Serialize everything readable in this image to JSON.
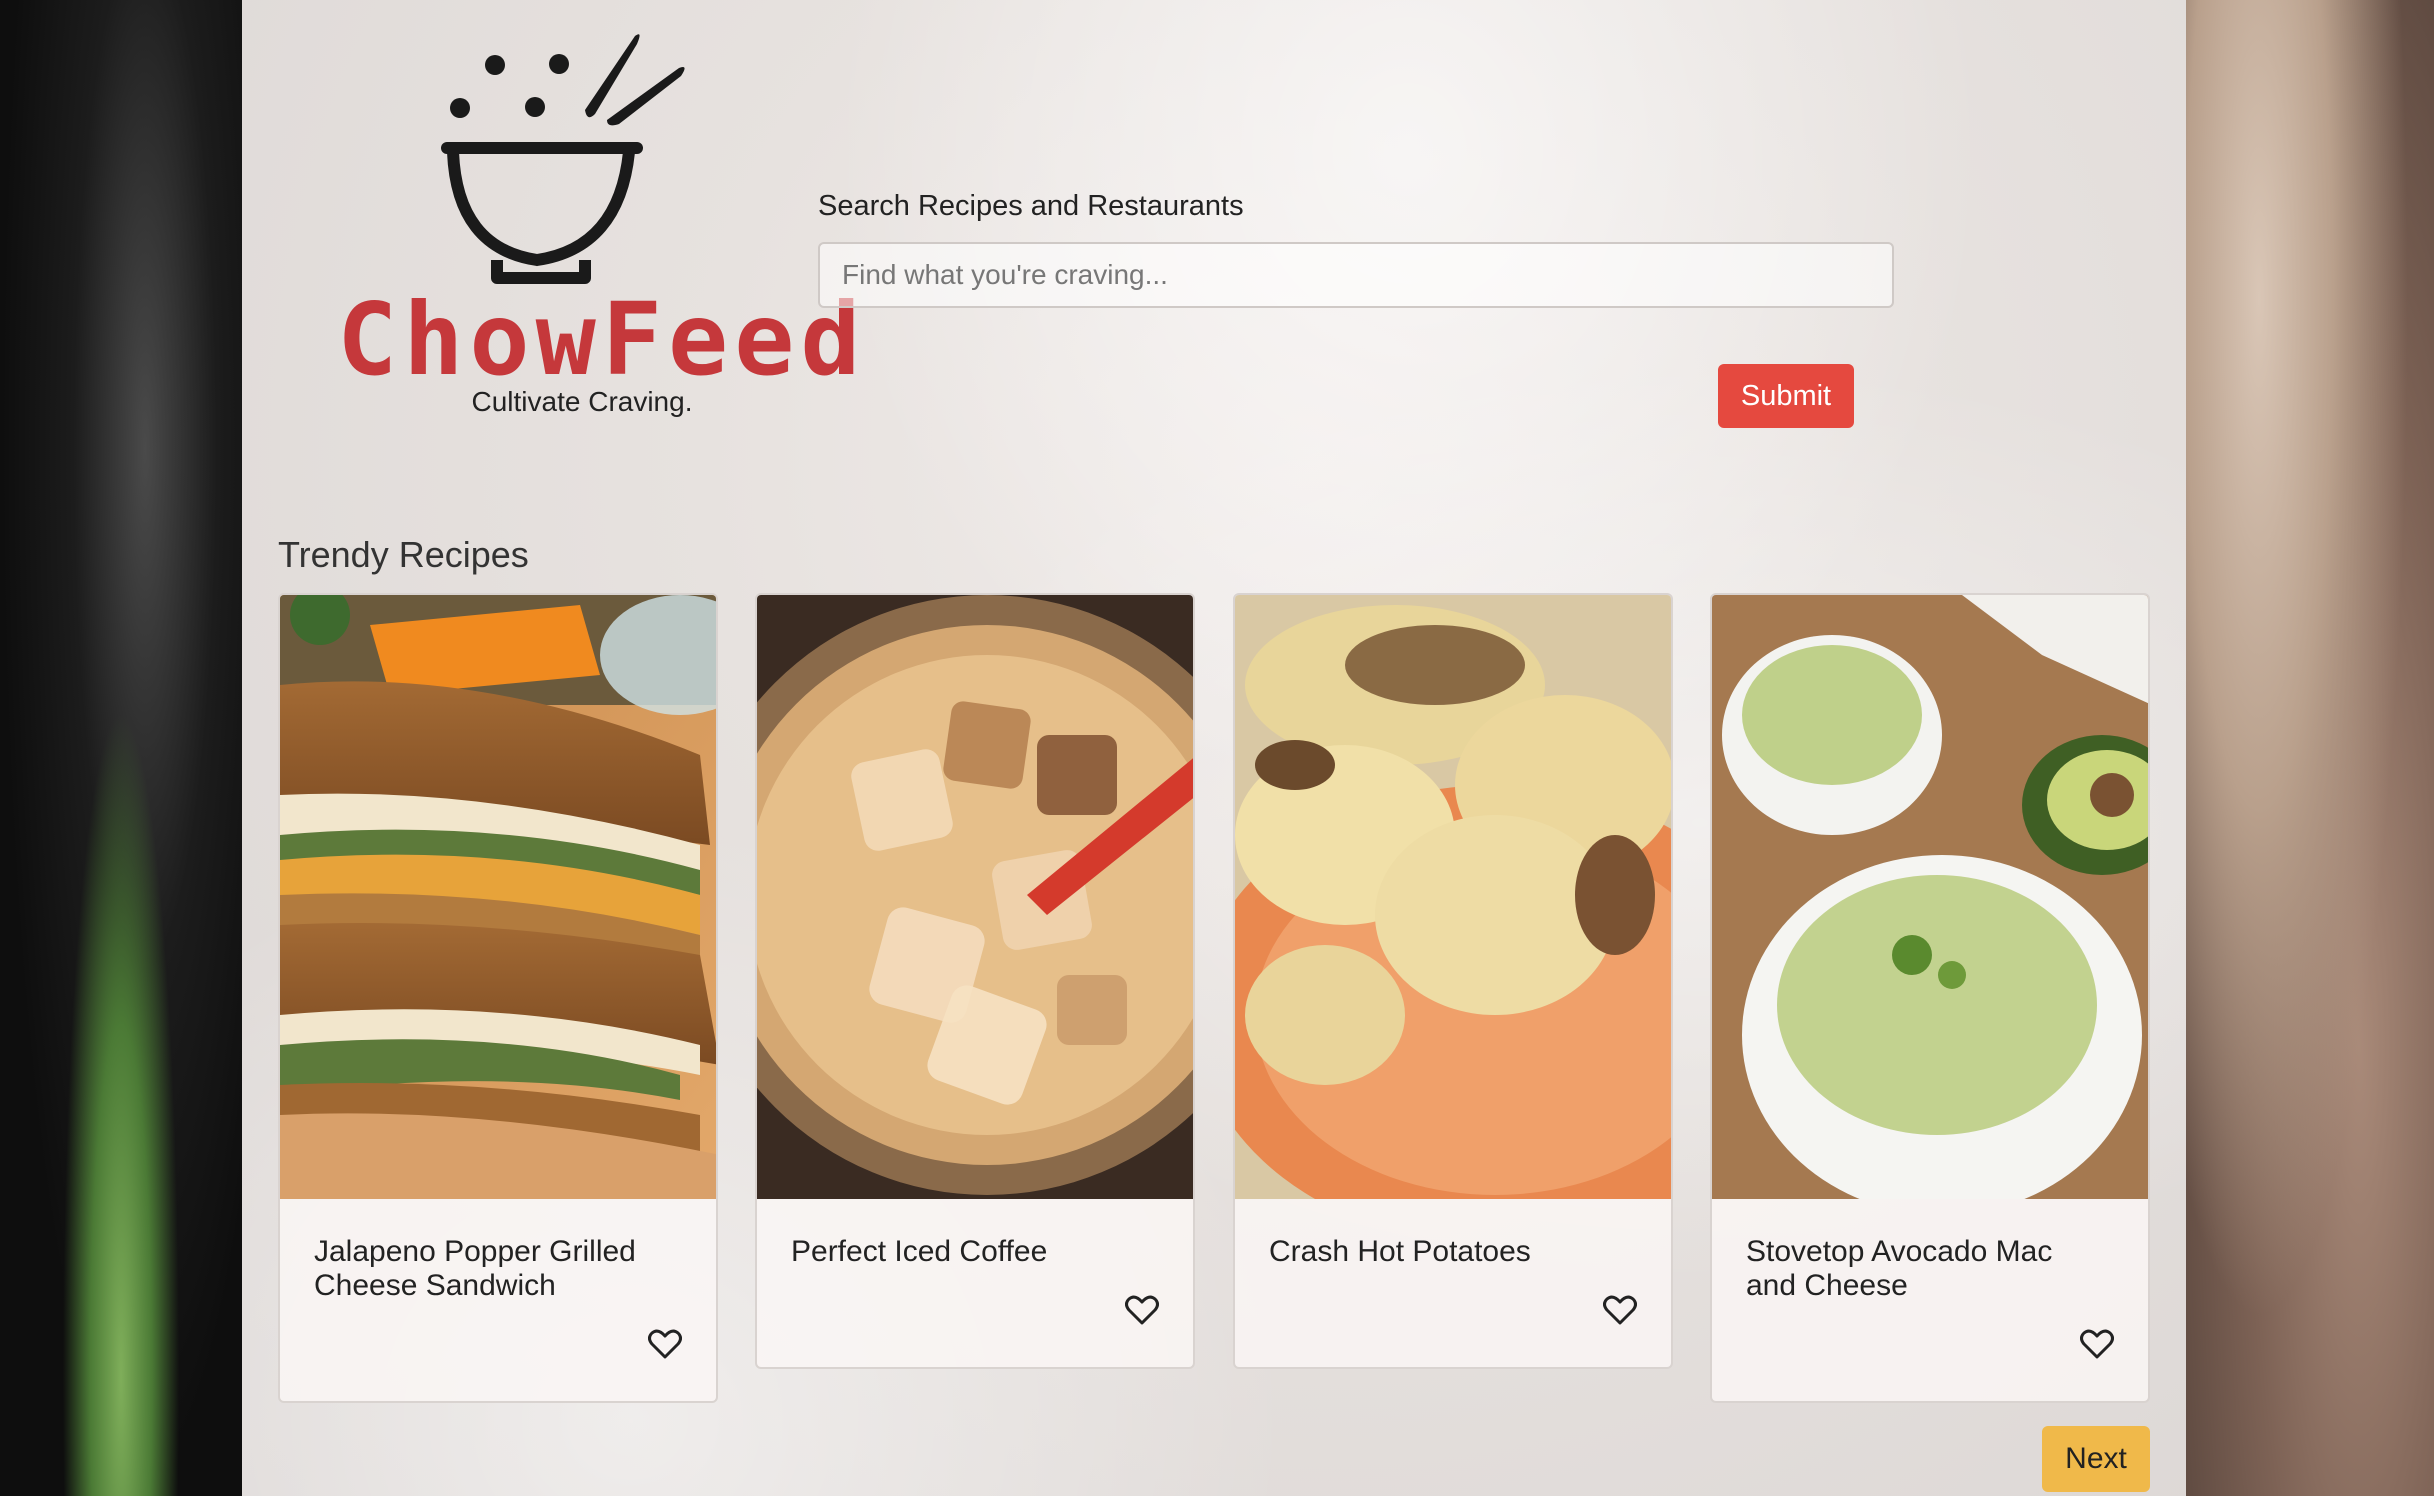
{
  "brand": {
    "name": "ChowFeed",
    "tagline": "Cultivate Craving.",
    "accent_color": "#c5383b"
  },
  "search": {
    "label": "Search Recipes and Restaurants",
    "placeholder": "Find what you're craving...",
    "value": "",
    "submit_label": "Submit",
    "submit_color": "#e5493f"
  },
  "trendy": {
    "title": "Trendy Recipes",
    "cards": [
      {
        "title": "Jalapeno Popper Grilled Cheese Sandwich",
        "image": "grilled-cheese-photo",
        "icon": "heart-outline-icon"
      },
      {
        "title": "Perfect Iced Coffee",
        "image": "iced-coffee-photo",
        "icon": "heart-outline-icon"
      },
      {
        "title": "Crash Hot Potatoes",
        "image": "crash-potatoes-photo",
        "icon": "heart-outline-icon"
      },
      {
        "title": "Stovetop Avocado Mac and Cheese",
        "image": "avocado-mac-photo",
        "icon": "heart-outline-icon"
      }
    ]
  },
  "pagination": {
    "next_label": "Next",
    "next_color": "#f0b94a"
  }
}
